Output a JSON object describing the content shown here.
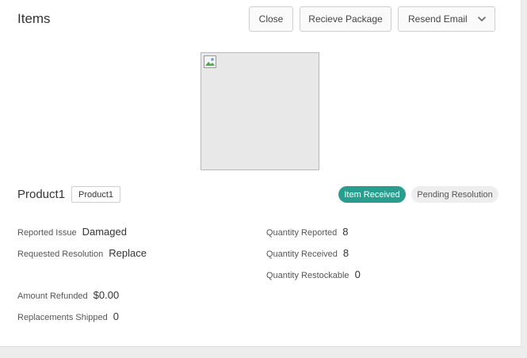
{
  "header": {
    "title": "Items",
    "close_label": "Close",
    "receive_label": "Recieve Package",
    "resend_label": "Resend Email"
  },
  "product": {
    "name": "Product1",
    "sku": "Product1",
    "status_received": "Item Received",
    "status_pending": "Pending Resolution"
  },
  "details": {
    "reported_issue_label": "Reported Issue",
    "reported_issue_value": "Damaged",
    "requested_resolution_label": "Requested Resolution",
    "requested_resolution_value": "Replace",
    "amount_refunded_label": "Amount Refunded",
    "amount_refunded_value": "$0.00",
    "replacements_shipped_label": "Replacements Shipped",
    "replacements_shipped_value": "0",
    "quantity_reported_label": "Quantity Reported",
    "quantity_reported_value": "8",
    "quantity_received_label": "Quantity Received",
    "quantity_received_value": "8",
    "quantity_restockable_label": "Quantity Restockable",
    "quantity_restockable_value": "0"
  },
  "colors": {
    "received_badge": "#2a9d8f",
    "pending_badge": "#eeeeee"
  },
  "icons": {
    "resend_dropdown": "chevron-down-icon",
    "product_image": "broken-image-icon"
  }
}
